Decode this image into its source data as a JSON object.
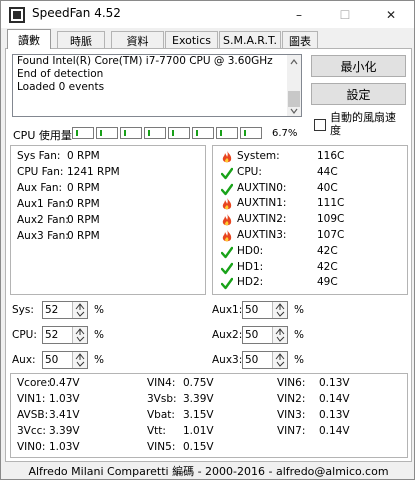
{
  "window": {
    "title": "SpeedFan 4.52",
    "minimize": "–",
    "maximize": "☐",
    "close": "✕"
  },
  "tabs": [
    "讀數",
    "時脈",
    "資料",
    "Exotics",
    "S.M.A.R.T.",
    "圖表"
  ],
  "log": [
    "Found Intel(R) Core(TM) i7-7700 CPU @ 3.60GHz",
    "End of detection",
    "Loaded 0 events"
  ],
  "buttons": {
    "minimize": "最小化",
    "settings": "設定"
  },
  "auto_fan": {
    "label_line1": "自動的風扇速",
    "label_line2": "度",
    "checked": false
  },
  "cpu_usage": {
    "label": "CPU 使用量",
    "percent": "6.7%",
    "bars": 8
  },
  "fans": [
    {
      "name": "Sys Fan:",
      "value": "0 RPM"
    },
    {
      "name": "CPU Fan:",
      "value": "1241 RPM"
    },
    {
      "name": "Aux Fan:",
      "value": "0 RPM"
    },
    {
      "name": "Aux1 Fan:",
      "value": "0 RPM"
    },
    {
      "name": "Aux2 Fan:",
      "value": "0 RPM"
    },
    {
      "name": "Aux3 Fan:",
      "value": "0 RPM"
    }
  ],
  "temps": [
    {
      "name": "System:",
      "value": "116C",
      "status": "hot"
    },
    {
      "name": "CPU:",
      "value": "44C",
      "status": "ok"
    },
    {
      "name": "AUXTIN0:",
      "value": "40C",
      "status": "ok"
    },
    {
      "name": "AUXTIN1:",
      "value": "111C",
      "status": "hot"
    },
    {
      "name": "AUXTIN2:",
      "value": "109C",
      "status": "hot"
    },
    {
      "name": "AUXTIN3:",
      "value": "107C",
      "status": "hot"
    },
    {
      "name": "HD0:",
      "value": "42C",
      "status": "ok"
    },
    {
      "name": "HD1:",
      "value": "42C",
      "status": "ok"
    },
    {
      "name": "HD2:",
      "value": "49C",
      "status": "ok"
    }
  ],
  "controls_left": [
    {
      "name": "Sys:",
      "value": "52"
    },
    {
      "name": "CPU:",
      "value": "52"
    },
    {
      "name": "Aux:",
      "value": "50"
    }
  ],
  "controls_right": [
    {
      "name": "Aux1:",
      "value": "50"
    },
    {
      "name": "Aux2:",
      "value": "50"
    },
    {
      "name": "Aux3:",
      "value": "50"
    }
  ],
  "pct_unit": "%",
  "volts": [
    [
      {
        "name": "Vcore:",
        "value": "0.47V"
      },
      {
        "name": "VIN1:",
        "value": "1.03V"
      },
      {
        "name": "AVSB:",
        "value": "3.41V"
      },
      {
        "name": "3Vcc:",
        "value": "3.39V"
      },
      {
        "name": "VIN0:",
        "value": "1.03V"
      }
    ],
    [
      {
        "name": "VIN4:",
        "value": "0.75V"
      },
      {
        "name": "3Vsb:",
        "value": "3.39V"
      },
      {
        "name": "Vbat:",
        "value": "3.15V"
      },
      {
        "name": "Vtt:",
        "value": "1.01V"
      },
      {
        "name": "VIN5:",
        "value": "0.15V"
      }
    ],
    [
      {
        "name": "VIN6:",
        "value": "0.13V"
      },
      {
        "name": "VIN2:",
        "value": "0.14V"
      },
      {
        "name": "VIN3:",
        "value": "0.13V"
      },
      {
        "name": "VIN7:",
        "value": "0.14V"
      }
    ]
  ],
  "footer": "Alfredo Milani Comparetti 編碼 - 2000-2016 - alfredo@almico.com",
  "colors": {
    "hot": "#e8451f",
    "ok": "#1aa31a",
    "fill": "#19a019"
  }
}
